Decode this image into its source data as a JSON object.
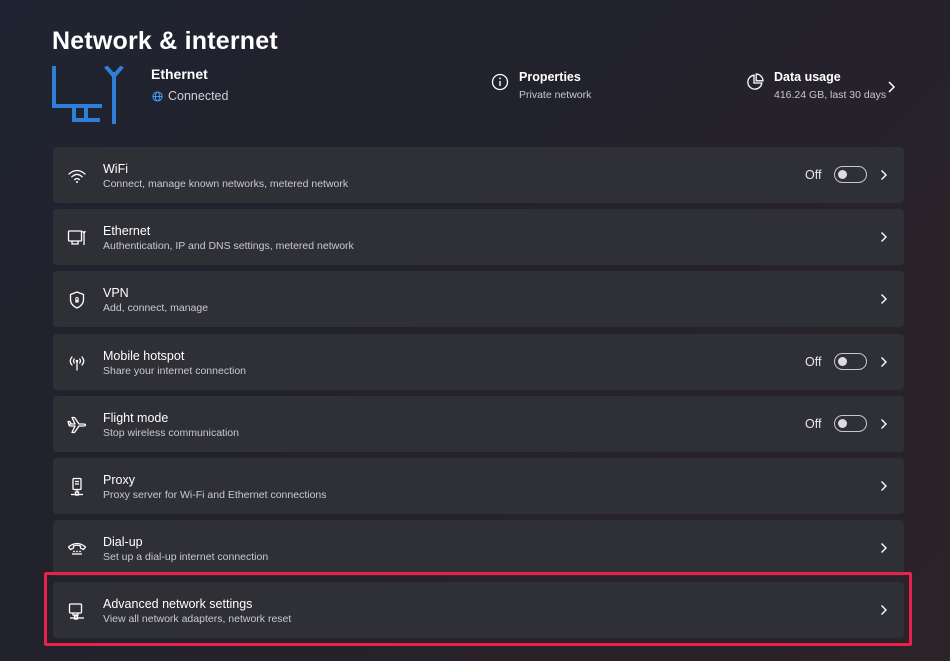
{
  "page": {
    "title": "Network & internet"
  },
  "hero": {
    "icon": "ethernet-large-icon",
    "name": "Ethernet",
    "status": "Connected",
    "status_icon": "globe-icon",
    "properties": {
      "icon": "info-icon",
      "title": "Properties",
      "subtitle": "Private network"
    },
    "data_usage": {
      "icon": "pie-chart-icon",
      "title": "Data usage",
      "subtitle": "416.24 GB, last 30 days"
    }
  },
  "colors": {
    "accent": "#2f7fd8",
    "highlight": "#e8214d",
    "card": "#2f2f36"
  },
  "settings": [
    {
      "icon": "wifi-icon",
      "title": "WiFi",
      "subtitle": "Connect, manage known networks, metered network",
      "toggle": "Off"
    },
    {
      "icon": "ethernet-icon",
      "title": "Ethernet",
      "subtitle": "Authentication, IP and DNS settings, metered network"
    },
    {
      "icon": "vpn-shield-icon",
      "title": "VPN",
      "subtitle": "Add, connect, manage"
    },
    {
      "icon": "hotspot-icon",
      "title": "Mobile hotspot",
      "subtitle": "Share your internet connection",
      "toggle": "Off"
    },
    {
      "icon": "airplane-icon",
      "title": "Flight mode",
      "subtitle": "Stop wireless communication",
      "toggle": "Off"
    },
    {
      "icon": "proxy-icon",
      "title": "Proxy",
      "subtitle": "Proxy server for Wi-Fi and Ethernet connections"
    },
    {
      "icon": "dialup-icon",
      "title": "Dial-up",
      "subtitle": "Set up a dial-up internet connection"
    },
    {
      "icon": "advanced-network-icon",
      "title": "Advanced network settings",
      "subtitle": "View all network adapters, network reset"
    }
  ]
}
